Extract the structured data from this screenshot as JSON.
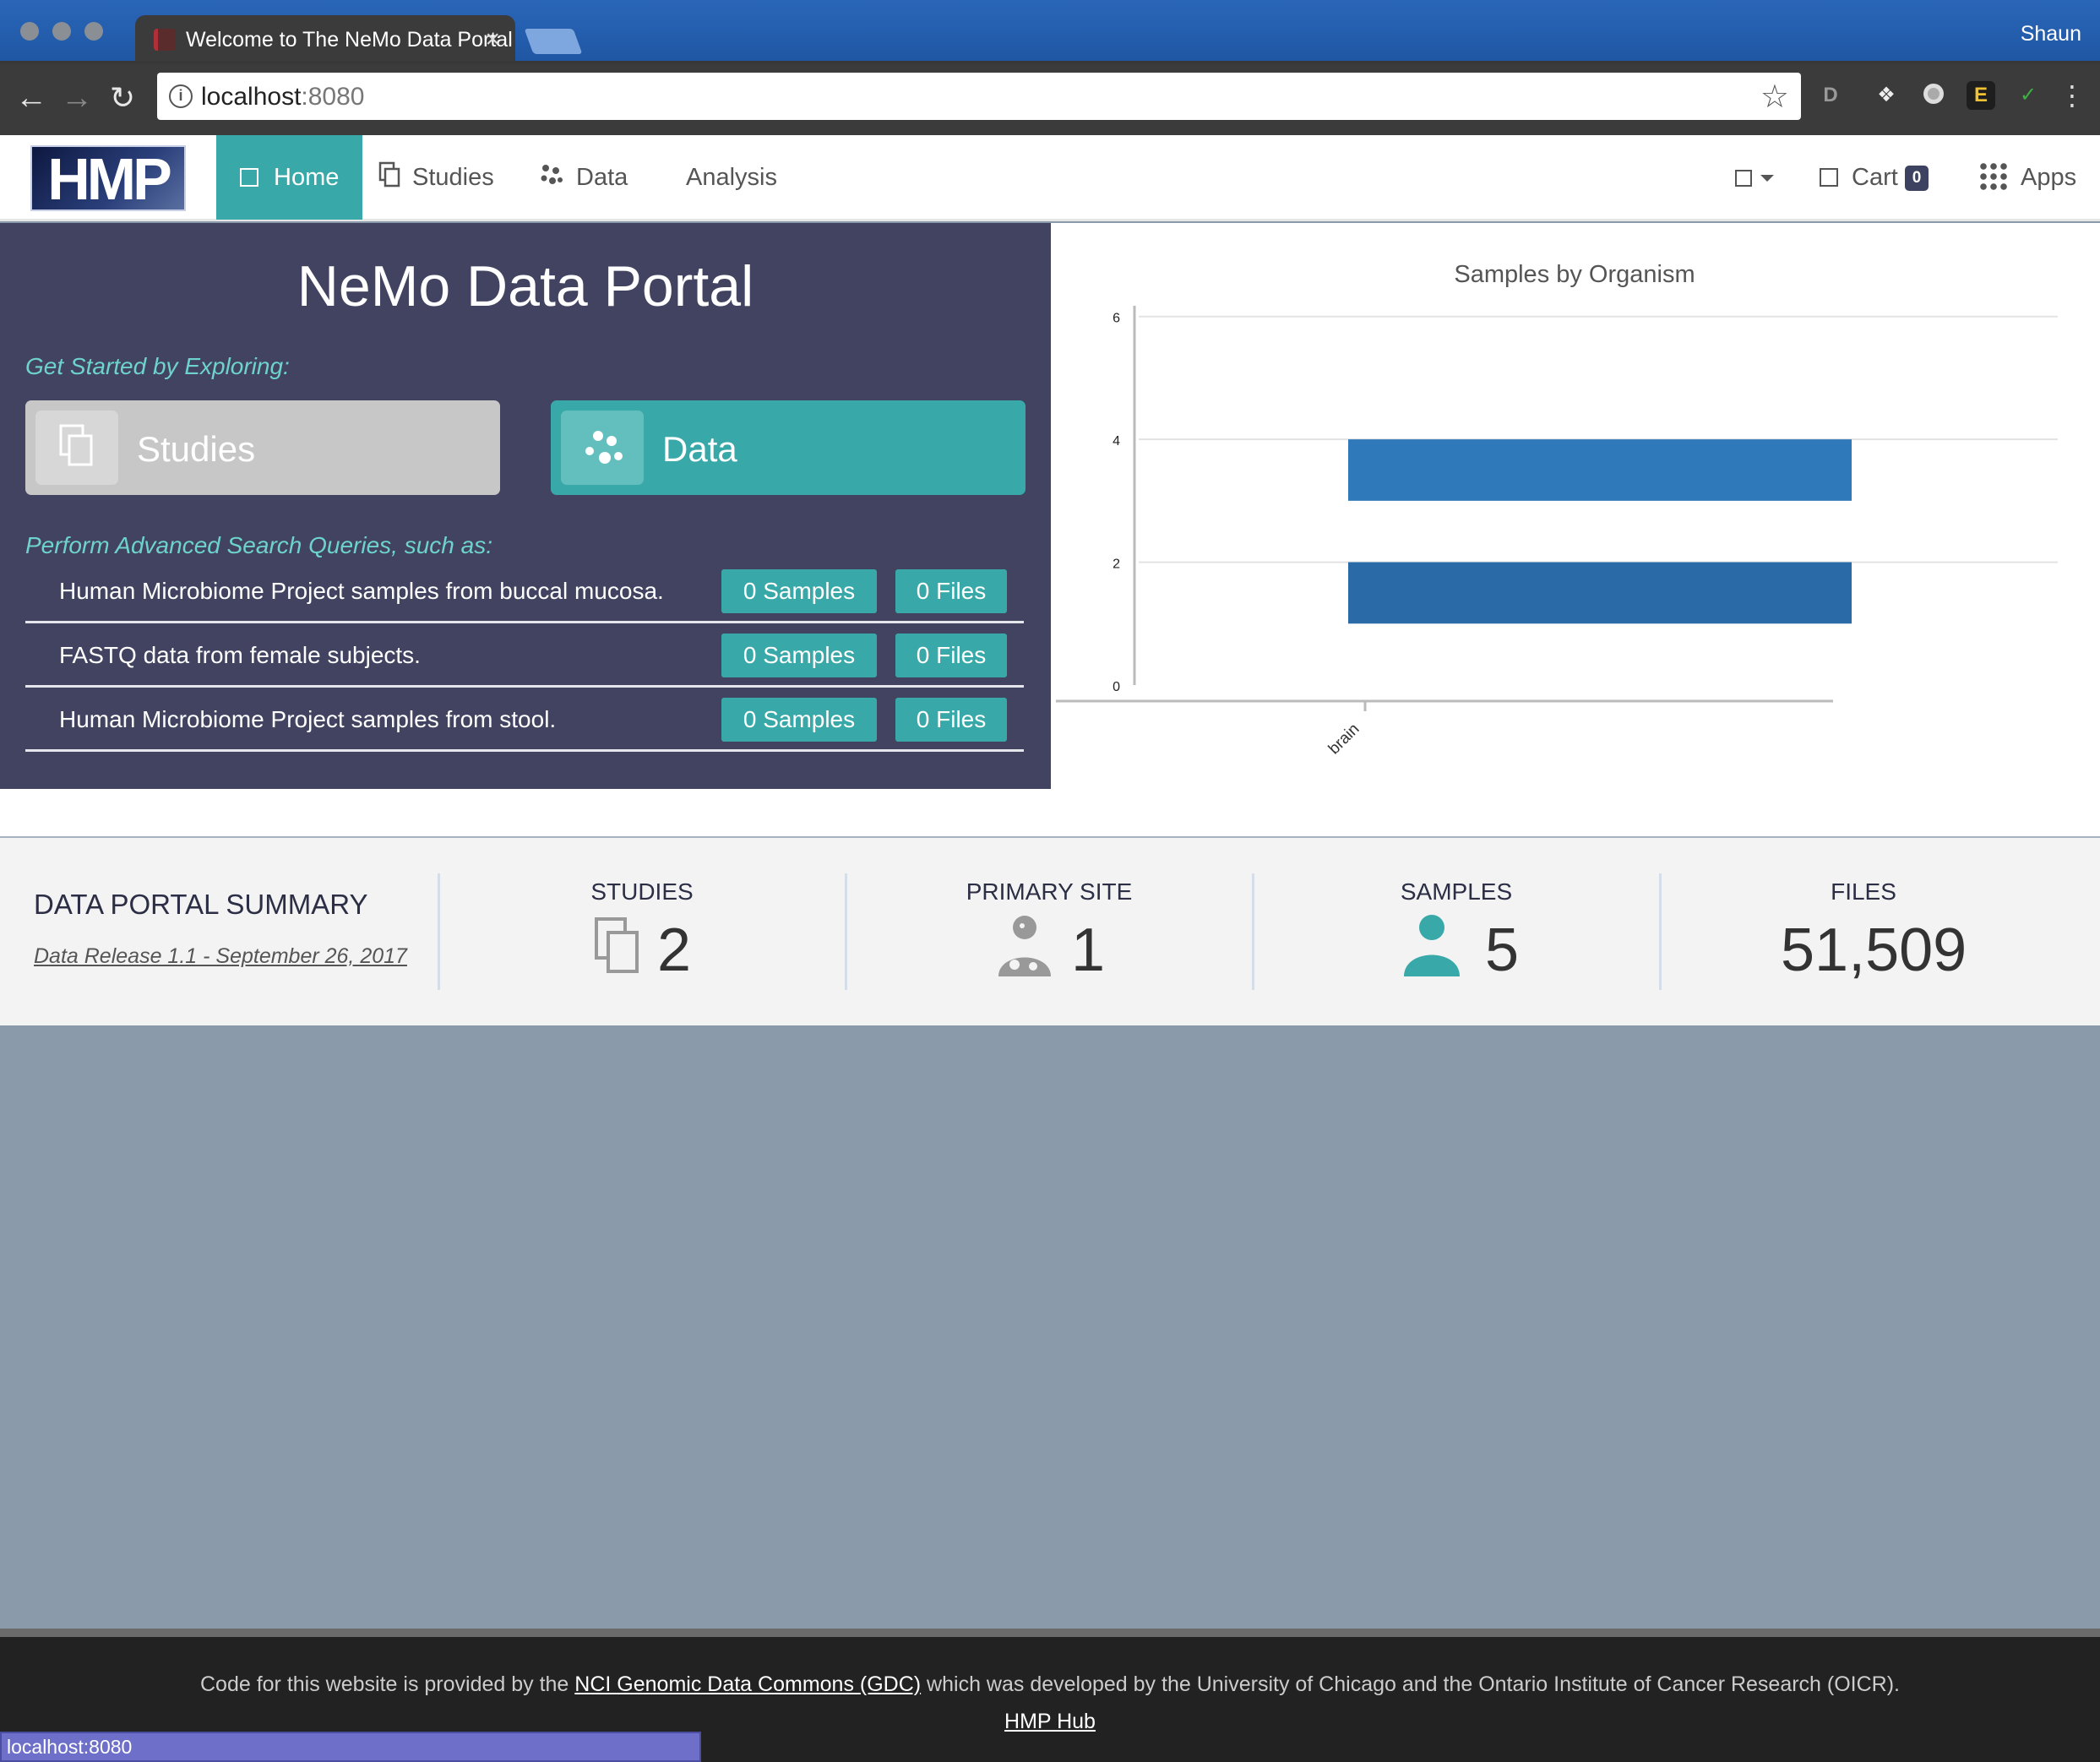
{
  "browser": {
    "tab_title": "Welcome to The NeMo Data Portal",
    "profile_name": "Shaun",
    "url_host": "localhost",
    "url_port": ":8080",
    "status_url": "localhost:8080"
  },
  "nav": {
    "logo_text": "HMP",
    "items": [
      {
        "label": "Home"
      },
      {
        "label": "Studies"
      },
      {
        "label": "Data"
      },
      {
        "label": "Analysis"
      }
    ],
    "cart_label": "Cart",
    "cart_count": "0",
    "apps_label": "Apps"
  },
  "hero": {
    "title": "NeMo Data Portal",
    "explore_heading": "Get Started by Exploring:",
    "explore_buttons": [
      {
        "label": "Studies"
      },
      {
        "label": "Data"
      }
    ],
    "queries_heading": "Perform Advanced Search Queries, such as:",
    "queries": [
      {
        "text": "Human Microbiome Project samples from buccal mucosa.",
        "samples": "0 Samples",
        "files": "0 Files"
      },
      {
        "text": "FASTQ data from female subjects.",
        "samples": "0 Samples",
        "files": "0 Files"
      },
      {
        "text": "Human Microbiome Project samples from stool.",
        "samples": "0 Samples",
        "files": "0 Files"
      }
    ]
  },
  "chart_data": {
    "type": "bar",
    "title": "Samples by Organism",
    "categories": [
      "brain"
    ],
    "segments": [
      {
        "start": 1,
        "end": 2,
        "color": "#2a6aa6"
      },
      {
        "start": 3,
        "end": 4,
        "color": "#2f78b9"
      }
    ],
    "ylim": [
      0,
      7
    ],
    "yticks": [
      "0",
      "2",
      "4",
      "6"
    ],
    "xlabel": "",
    "ylabel": "",
    "grid": true
  },
  "summary": {
    "title": "DATA PORTAL SUMMARY",
    "release": "Data Release 1.1 - September 26, 2017",
    "stats": [
      {
        "label": "STUDIES",
        "value": "2"
      },
      {
        "label": "PRIMARY SITE",
        "value": "1"
      },
      {
        "label": "SAMPLES",
        "value": "5"
      },
      {
        "label": "FILES",
        "value": "51,509"
      }
    ]
  },
  "footer": {
    "prefix": "Code for this website is provided by the ",
    "link": "NCI Genomic Data Commons (GDC)",
    "suffix": " which was developed by the University of Chicago and the Ontario Institute of Cancer Research (OICR).",
    "hub": "HMP Hub"
  },
  "colors": {
    "accent": "#38a9a8",
    "hero_bg": "#414360",
    "bar_dark": "#2a6aa6",
    "bar_light": "#2f78b9"
  }
}
